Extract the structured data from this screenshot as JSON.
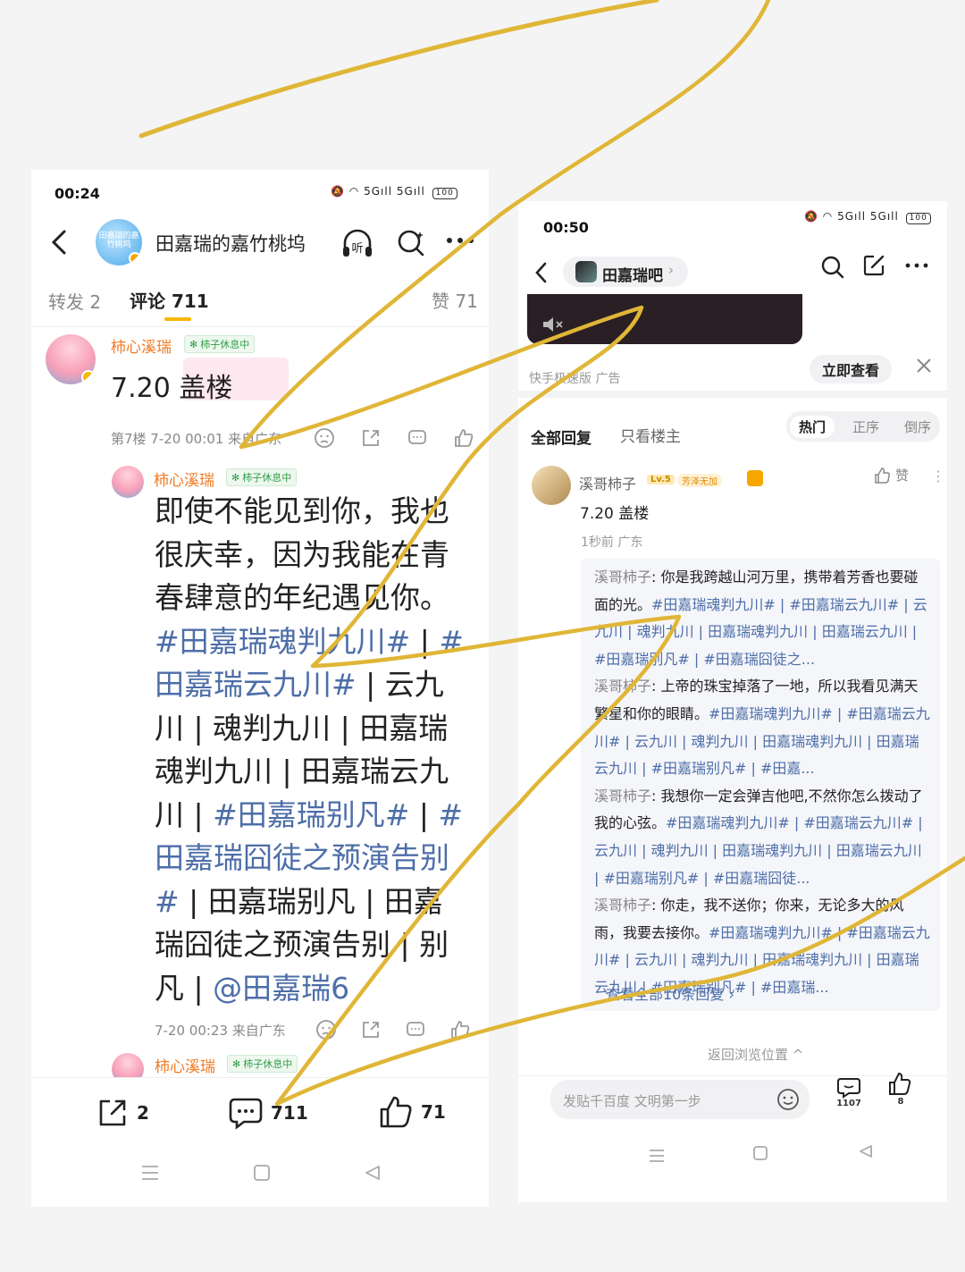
{
  "left": {
    "status": {
      "time": "00:24",
      "network_a": "5G",
      "network_b": "5G",
      "battery": "100"
    },
    "header": {
      "title": "田嘉瑞的嘉竹桃坞",
      "avatar_text": "田嘉瑞的嘉竹桃坞"
    },
    "tabs": [
      {
        "label": "转发 2"
      },
      {
        "label": "评论 711"
      },
      {
        "label": "赞 71"
      }
    ],
    "post": {
      "user": "柿心溪瑞",
      "badge": "柿子休息中",
      "text": "7.20 盖楼",
      "meta": "第7楼 7-20 00:01 来自广东"
    },
    "reply": {
      "user": "柿心溪瑞",
      "badge": "柿子休息中",
      "segments": [
        {
          "t": "即使不能见到你，我也很庆幸，因为我能在青春肆意的年纪遇见你。",
          "tag": false
        },
        {
          "t": "#田嘉瑞魂判九川#",
          "tag": true
        },
        {
          "t": " | ",
          "tag": false
        },
        {
          "t": "#田嘉瑞云九川#",
          "tag": true
        },
        {
          "t": " | 云九川 | 魂判九川 | 田嘉瑞魂判九川 | 田嘉瑞云九川 | ",
          "tag": false
        },
        {
          "t": "#田嘉瑞别凡#",
          "tag": true
        },
        {
          "t": " | ",
          "tag": false
        },
        {
          "t": "#田嘉瑞囧徒之预演告别#",
          "tag": true
        },
        {
          "t": " | 田嘉瑞别凡 | 田嘉瑞囧徒之预演告别 | 别凡 | ",
          "tag": false
        },
        {
          "t": "@田嘉瑞6",
          "tag": true
        }
      ],
      "meta": "7-20 00:23 来自广东"
    },
    "next_reply": {
      "user": "柿心溪瑞",
      "badge": "柿子休息中"
    },
    "bottom": {
      "repost": "2",
      "comment": "711",
      "like": "71"
    }
  },
  "right": {
    "status": {
      "time": "00:50",
      "network_a": "5G",
      "network_b": "5G",
      "battery": "100"
    },
    "header": {
      "forum": "田嘉瑞吧"
    },
    "ad": {
      "meta": "快手极速版 广告",
      "button": "立即查看"
    },
    "tabs": [
      {
        "label": "全部回复"
      },
      {
        "label": "只看楼主"
      }
    ],
    "sort": [
      {
        "label": "热门"
      },
      {
        "label": "正序"
      },
      {
        "label": "倒序"
      }
    ],
    "post": {
      "user": "溪哥柿子",
      "level": "Lv.5",
      "title_badge": "芳泽无加",
      "like_label": "赞",
      "text": "7.20 盖楼",
      "meta": "1秒前 广东"
    },
    "sub_replies": [
      {
        "name": "溪哥柿子",
        "text": "你是我跨越山河万里，携带着芳香也要碰面的光。",
        "tags": "#田嘉瑞魂判九川# | #田嘉瑞云九川# | 云九川 | 魂判九川 | 田嘉瑞魂判九川 | 田嘉瑞云九川 | #田嘉瑞别凡# | #田嘉瑞囧徒之..."
      },
      {
        "name": "溪哥柿子",
        "text": "上帝的珠宝掉落了一地，所以我看见满天繁星和你的眼睛。",
        "tags": "#田嘉瑞魂判九川# | #田嘉瑞云九川# | 云九川 | 魂判九川 | 田嘉瑞魂判九川 | 田嘉瑞云九川 | #田嘉瑞别凡# | #田嘉..."
      },
      {
        "name": "溪哥柿子",
        "text": "我想你一定会弹吉他吧,不然你怎么拨动了我的心弦。",
        "tags": "#田嘉瑞魂判九川# | #田嘉瑞云九川# | 云九川 | 魂判九川 | 田嘉瑞魂判九川 | 田嘉瑞云九川 | #田嘉瑞别凡# | #田嘉瑞囧徒..."
      },
      {
        "name": "溪哥柿子",
        "text": "你走，我不送你；你来，无论多大的风雨，我要去接你。",
        "tags": "#田嘉瑞魂判九川# | #田嘉瑞云九川# | 云九川 | 魂判九川 | 田嘉瑞魂判九川 | 田嘉瑞云九川 | #田嘉瑞别凡# | #田嘉瑞..."
      }
    ],
    "view_all": "查看全部10条回复 ›",
    "return_label": "返回浏览位置 ^",
    "input_placeholder": "发贴千百度 文明第一步",
    "bottom": {
      "comments": "1107",
      "likes": "8"
    }
  },
  "colors": {
    "accent_yellow": "#f6b700",
    "tag_blue": "#4d6ea8",
    "name_orange": "#f07b24",
    "badge_green": "#2e9e46",
    "scribble": "#e0b637"
  }
}
